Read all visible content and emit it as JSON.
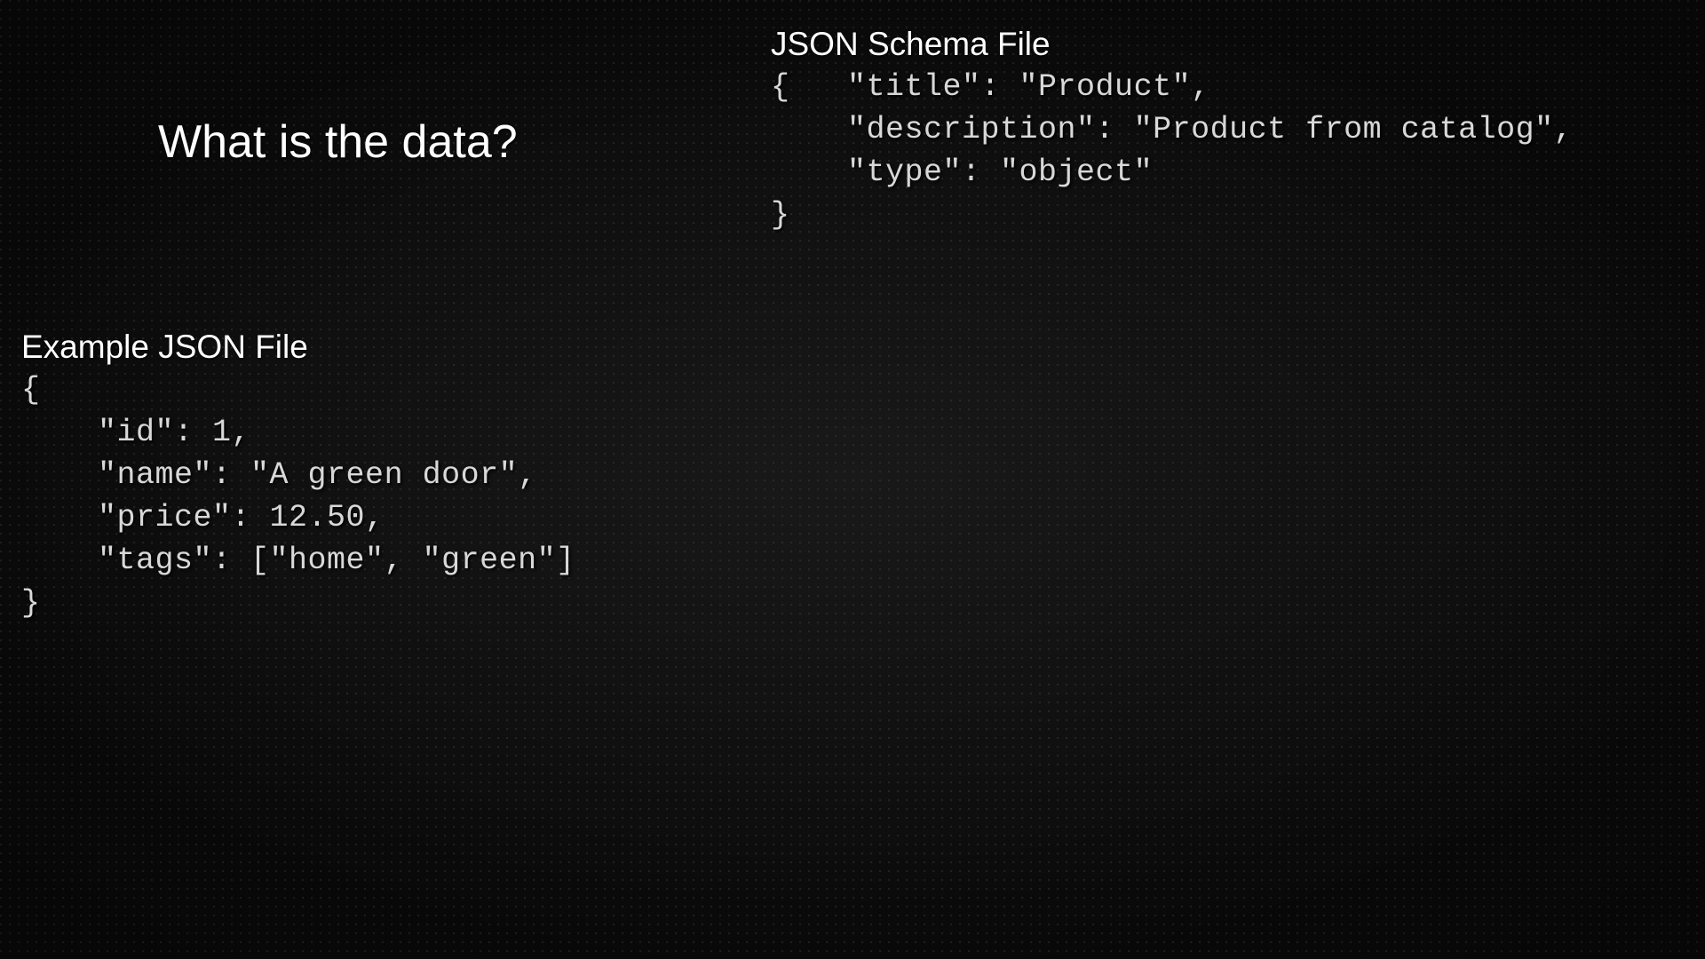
{
  "title": "What is the data?",
  "schema": {
    "label": "JSON Schema File",
    "code": "{   \"title\": \"Product\",\n    \"description\": \"Product from catalog\",\n    \"type\": \"object\"\n}"
  },
  "example": {
    "label": "Example JSON File",
    "code": "{\n    \"id\": 1,\n    \"name\": \"A green door\",\n    \"price\": 12.50,\n    \"tags\": [\"home\", \"green\"]\n}"
  }
}
